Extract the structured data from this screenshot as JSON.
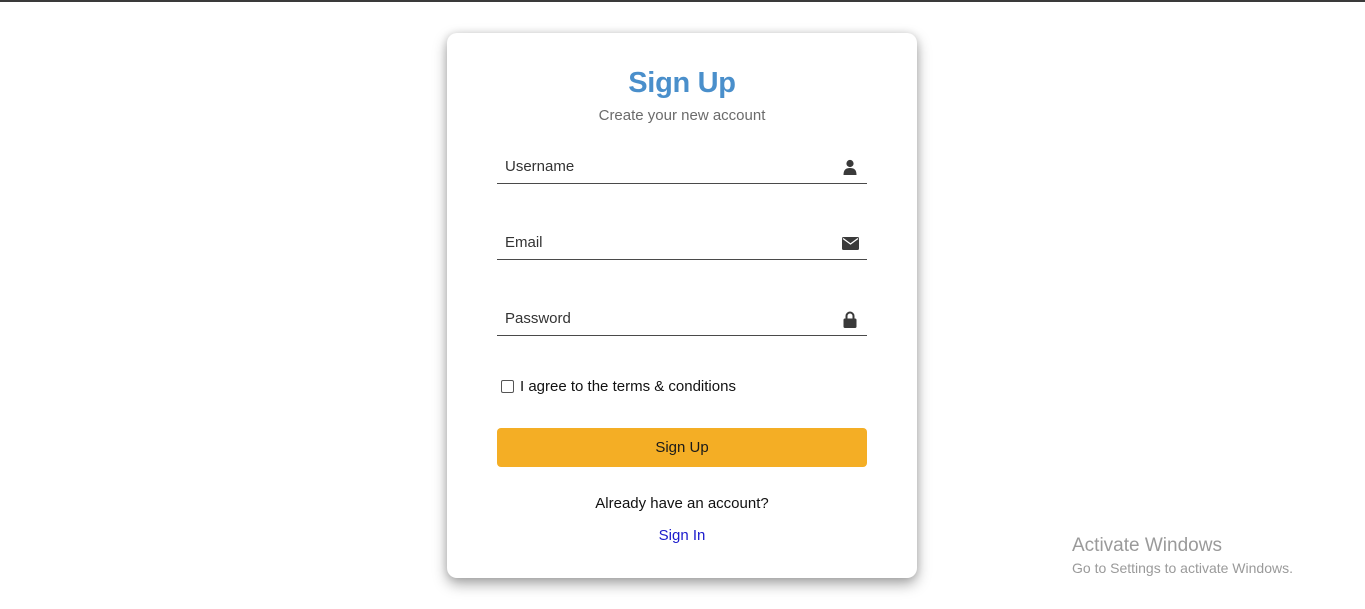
{
  "form": {
    "title": "Sign Up",
    "subtitle": "Create your new account",
    "username": {
      "placeholder": "Username",
      "icon": "user-icon"
    },
    "email": {
      "placeholder": "Email",
      "icon": "envelope-icon"
    },
    "password": {
      "placeholder": "Password",
      "icon": "lock-icon"
    },
    "terms_label": "I agree to the terms & conditions",
    "terms_checked": false,
    "submit_label": "Sign Up",
    "account_prompt": "Already have an account?",
    "signin_link": "Sign In"
  },
  "colors": {
    "title": "#4a8fcb",
    "button": "#f4ae25",
    "link": "#1a1acc"
  },
  "watermark": {
    "line1": "Activate Windows",
    "line2": "Go to Settings to activate Windows."
  }
}
